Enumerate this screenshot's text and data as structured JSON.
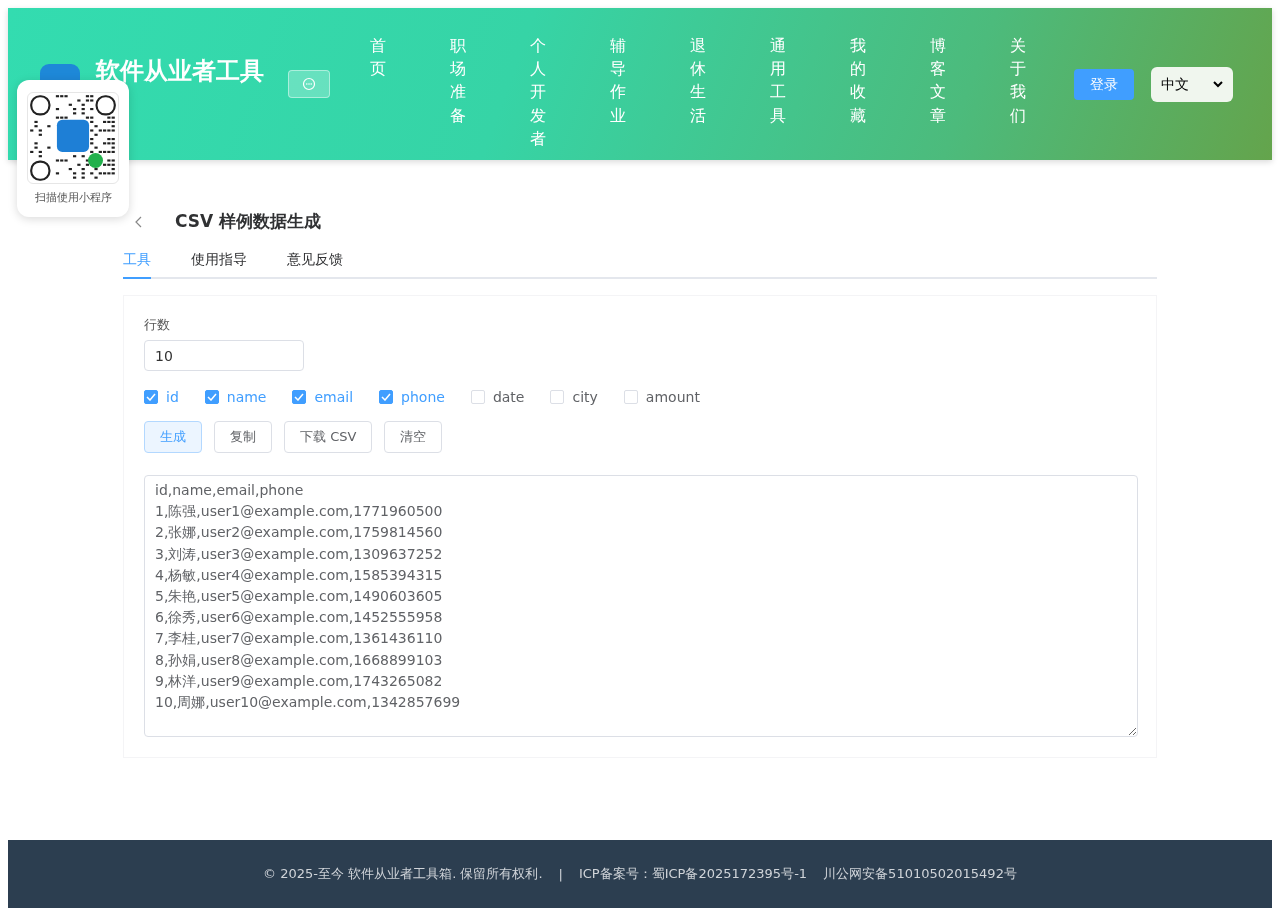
{
  "header": {
    "site_title": "软件从业者工具",
    "nav": [
      {
        "label": "首页"
      },
      {
        "label": "职场准备"
      },
      {
        "label": "个人开发者"
      },
      {
        "label": "辅导作业"
      },
      {
        "label": "退休生活"
      },
      {
        "label": "通用工具"
      },
      {
        "label": "我的收藏"
      },
      {
        "label": "博客文章"
      },
      {
        "label": "关于我们"
      }
    ],
    "login": "登录",
    "language": "中文"
  },
  "qr_popup": {
    "caption": "扫描使用小程序"
  },
  "page": {
    "title": "CSV 样例数据生成",
    "tabs": [
      {
        "label": "工具",
        "selected": true
      },
      {
        "label": "使用指导",
        "selected": false
      },
      {
        "label": "意见反馈",
        "selected": false
      }
    ]
  },
  "form": {
    "rows_label": "行数",
    "rows_value": "10",
    "fields": [
      {
        "label": "id",
        "checked": true
      },
      {
        "label": "name",
        "checked": true
      },
      {
        "label": "email",
        "checked": true
      },
      {
        "label": "phone",
        "checked": true
      },
      {
        "label": "date",
        "checked": false
      },
      {
        "label": "city",
        "checked": false
      },
      {
        "label": "amount",
        "checked": false
      }
    ],
    "buttons": [
      {
        "label": "生成",
        "kind": "primary"
      },
      {
        "label": "复制",
        "kind": "plain"
      },
      {
        "label": "下载 CSV",
        "kind": "plain"
      },
      {
        "label": "清空",
        "kind": "plain"
      }
    ],
    "output": [
      "id,name,email,phone",
      "1,陈强,user1@example.com,1771960500",
      "2,张娜,user2@example.com,1759814560",
      "3,刘涛,user3@example.com,1309637252",
      "4,杨敏,user4@example.com,1585394315",
      "5,朱艳,user5@example.com,1490603605",
      "6,徐秀,user6@example.com,1452555958",
      "7,李桂,user7@example.com,1361436110",
      "8,孙娟,user8@example.com,1668899103",
      "9,林洋,user9@example.com,1743265082",
      "10,周娜,user10@example.com,1342857699"
    ]
  },
  "footer": {
    "copyright": "© 2025-至今 软件从业者工具箱. 保留所有权利.",
    "separator": "|",
    "icp": "ICP备案号：蜀ICP备2025172395号-1",
    "police": "川公网安备51010502015492号"
  }
}
